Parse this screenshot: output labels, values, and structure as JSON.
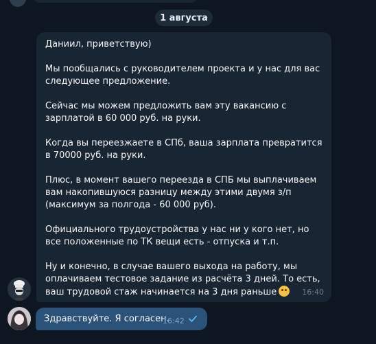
{
  "date_divider": "1 августа",
  "incoming": {
    "paragraphs": [
      "Даниил, приветствую)",
      "Мы пообщались с руководителем проекта и у нас для вас следующее предложение.",
      "Сейчас мы можем предложить вам эту вакансию с зарплатой в 60 000 руб. на руки.",
      "Когда вы переезжаете в СПб, ваша зарплата превратится в 70000 руб. на руки.",
      "Плюс, в момент вашего переезда в СПБ мы выплачиваем вам накопившуюся разницу между этими двумя з/п (максимум за полгода - 60 000 руб).",
      "Официального трудоустройства у нас ни у кого нет, но все положенные по ТК вещи есть - отпуска и т.п.",
      "Ну и конечно, в случае вашего выхода на работу, мы оплачиваем тестовое задание из расчёта 3 дней. То есть, ваш трудовой стаж начинается на 3 дня раньше"
    ],
    "emoji": "smiling-face-emoji",
    "time": "16:40"
  },
  "outgoing": {
    "text": "Здравствуйте. Я согласен.",
    "time": "16:42",
    "status_icon": "single-check-icon"
  },
  "colors": {
    "background": "#0e1621",
    "incoming_bubble": "#182533",
    "outgoing_bubble": "#2b5278",
    "date_chip": "#1e2c3a",
    "check": "#5eb5f7"
  }
}
